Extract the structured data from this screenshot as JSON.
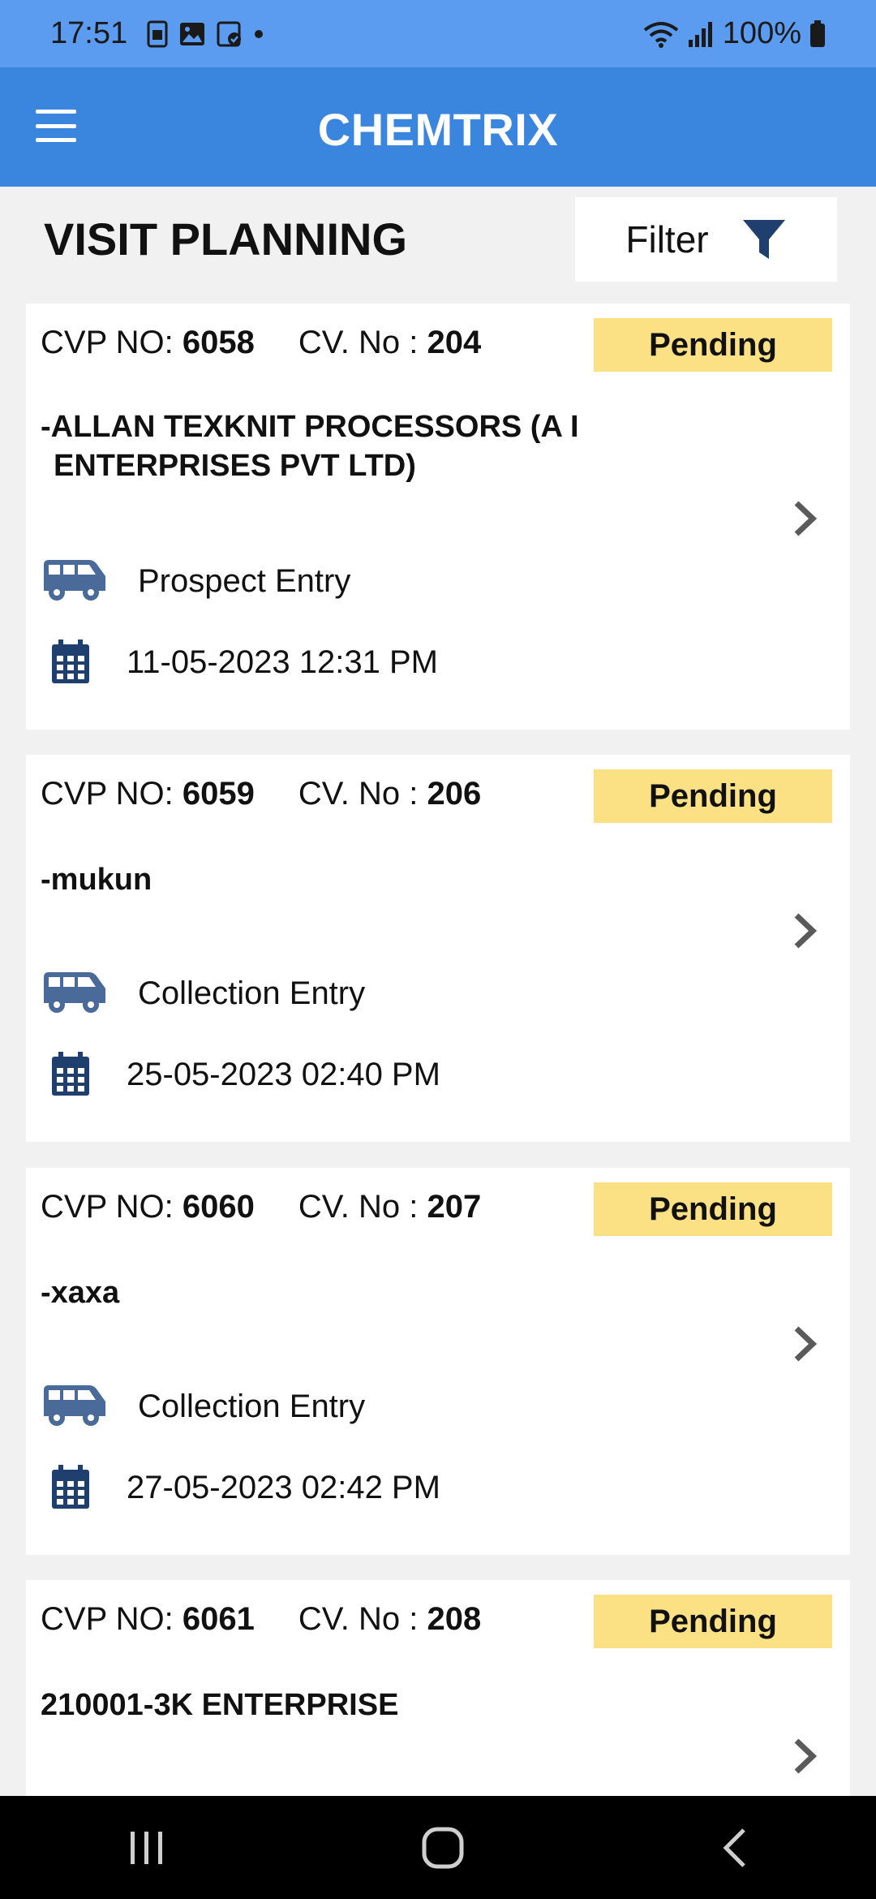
{
  "status": {
    "time": "17:51",
    "battery": "100%"
  },
  "app_bar": {
    "title": "CHEMTRIX"
  },
  "page": {
    "title": "VISIT PLANNING",
    "filter_label": "Filter"
  },
  "labels": {
    "cvp": "CVP NO: ",
    "cv": "CV. No : "
  },
  "cards": [
    {
      "cvp_no": "6058",
      "cv_no": "204",
      "status": "Pending",
      "party_line1": "-ALLAN TEXKNIT PROCESSORS (A I",
      "party_line2": "ENTERPRISES PVT LTD)",
      "entry_type": "Prospect Entry",
      "datetime": "11-05-2023 12:31 PM"
    },
    {
      "cvp_no": "6059",
      "cv_no": "206",
      "status": "Pending",
      "party_line1": "-mukun",
      "entry_type": "Collection Entry",
      "datetime": "25-05-2023 02:40 PM"
    },
    {
      "cvp_no": "6060",
      "cv_no": "207",
      "status": "Pending",
      "party_line1": "-xaxa",
      "entry_type": "Collection Entry",
      "datetime": "27-05-2023 02:42 PM"
    },
    {
      "cvp_no": "6061",
      "cv_no": "208",
      "status": "Pending",
      "party_line1": "210001-3K ENTERPRISE"
    }
  ],
  "colors": {
    "status_bar": "#5b9cf0",
    "app_bar": "#3a85de",
    "badge": "#fbe084",
    "icon": "#4a6a9a",
    "calendar_icon": "#1f3f6e"
  }
}
